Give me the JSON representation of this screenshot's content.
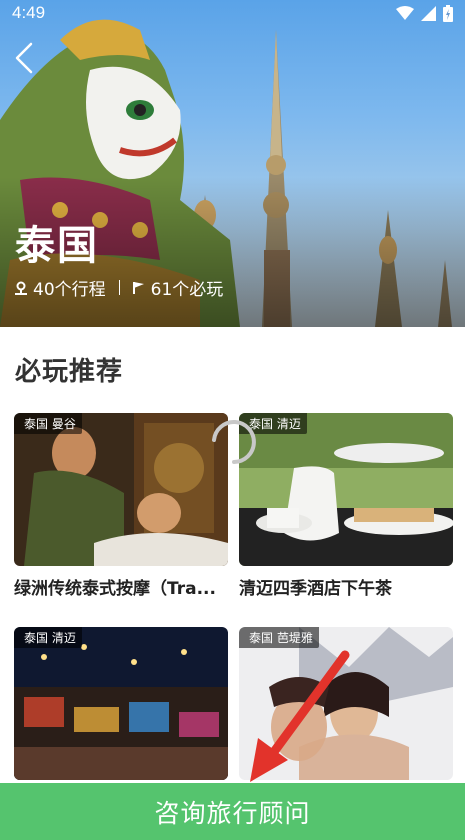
{
  "status_bar": {
    "time": "4:49"
  },
  "hero": {
    "title": "泰国",
    "trips": "40个行程",
    "must_play": "61个必玩"
  },
  "section": {
    "title": "必玩推荐"
  },
  "cards": [
    {
      "tag": "泰国 曼谷",
      "name": "绿洲传统泰式按摩（Tra..."
    },
    {
      "tag": "泰国 清迈",
      "name": "清迈四季酒店下午茶"
    },
    {
      "tag": "泰国 清迈",
      "name": ""
    },
    {
      "tag": "泰国 芭堤雅",
      "name": ""
    }
  ],
  "consult_button": "咨询旅行顾问",
  "colors": {
    "accent_green": "#55c46e",
    "overlay_arrow": "#e2332b"
  }
}
